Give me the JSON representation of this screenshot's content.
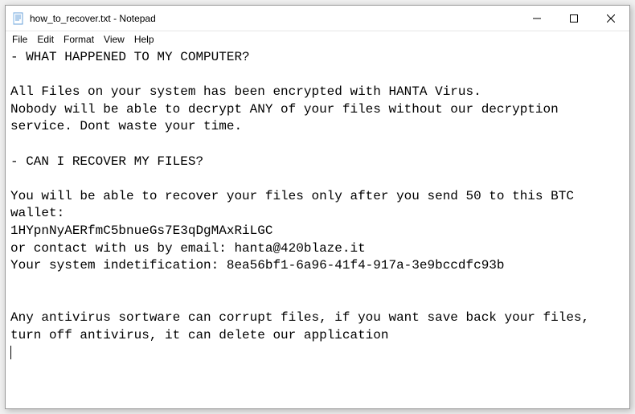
{
  "titlebar": {
    "filename": "how_to_recover.txt",
    "appname": "Notepad"
  },
  "menubar": {
    "items": [
      "File",
      "Edit",
      "Format",
      "View",
      "Help"
    ]
  },
  "document": {
    "text": "- WHAT HAPPENED TO MY COMPUTER?\n\nAll Files on your system has been encrypted with HANTA Virus.\nNobody will be able to decrypt ANY of your files without our decryption service. Dont waste your time.\n\n- CAN I RECOVER MY FILES?\n\nYou will be able to recover your files only after you send 50 to this BTC wallet:\n1HYpnNyAERfmC5bnueGs7E3qDgMAxRiLGC\nor contact with us by email: hanta@420blaze.it\nYour system indetification: 8ea56bf1-6a96-41f4-917a-3e9bccdfc93b\n\n\nAny antivirus sortware can corrupt files, if you want save back your files, turn off antivirus, it can delete our application\n"
  }
}
